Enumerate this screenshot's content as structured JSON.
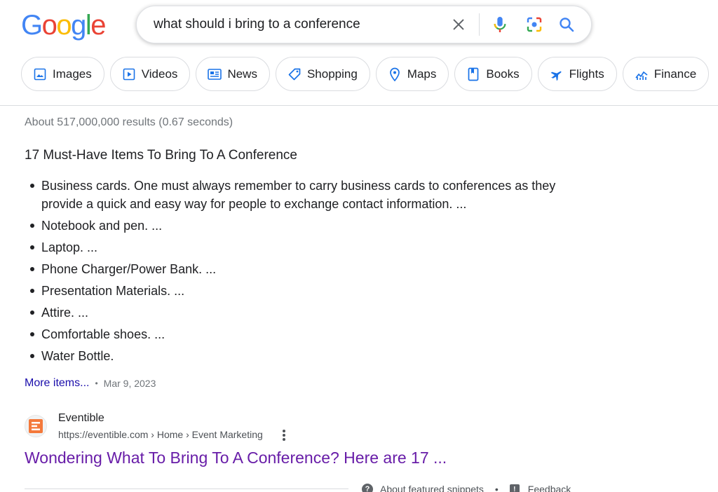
{
  "logo": {
    "letters": [
      "G",
      "o",
      "o",
      "g",
      "l",
      "e"
    ],
    "colors": [
      "#4285F4",
      "#EA4335",
      "#FBBC05",
      "#4285F4",
      "#34A853",
      "#EA4335"
    ]
  },
  "search": {
    "query": "what should i bring to a conference"
  },
  "chips": [
    {
      "label": "Images",
      "icon": "image-icon"
    },
    {
      "label": "Videos",
      "icon": "video-icon"
    },
    {
      "label": "News",
      "icon": "news-icon"
    },
    {
      "label": "Shopping",
      "icon": "tag-icon"
    },
    {
      "label": "Maps",
      "icon": "map-pin-icon"
    },
    {
      "label": "Books",
      "icon": "book-icon"
    },
    {
      "label": "Flights",
      "icon": "plane-icon"
    },
    {
      "label": "Finance",
      "icon": "finance-chart-icon"
    }
  ],
  "stats": "About 517,000,000 results (0.67 seconds)",
  "snippet": {
    "title": "17 Must-Have Items To Bring To A Conference",
    "items": [
      "Business cards. One must always remember to carry business cards to conferences as they provide a quick and easy way for people to exchange contact information. ...",
      "Notebook and pen. ...",
      "Laptop. ...",
      "Phone Charger/Power Bank. ...",
      "Presentation Materials. ...",
      "Attire. ...",
      "Comfortable shoes. ...",
      "Water Bottle."
    ],
    "more_link": "More items...",
    "date": "Mar 9, 2023"
  },
  "result": {
    "site_name": "Eventible",
    "url": "https://eventible.com › Home › Event Marketing",
    "title": "Wondering What To Bring To A Conference? Here are 17 ..."
  },
  "footer": {
    "about": "About featured snippets",
    "separator": "•",
    "feedback": "Feedback"
  },
  "colors": {
    "link": "#1a0dab",
    "visited": "#681da8",
    "accent_blue": "#4285F4"
  }
}
